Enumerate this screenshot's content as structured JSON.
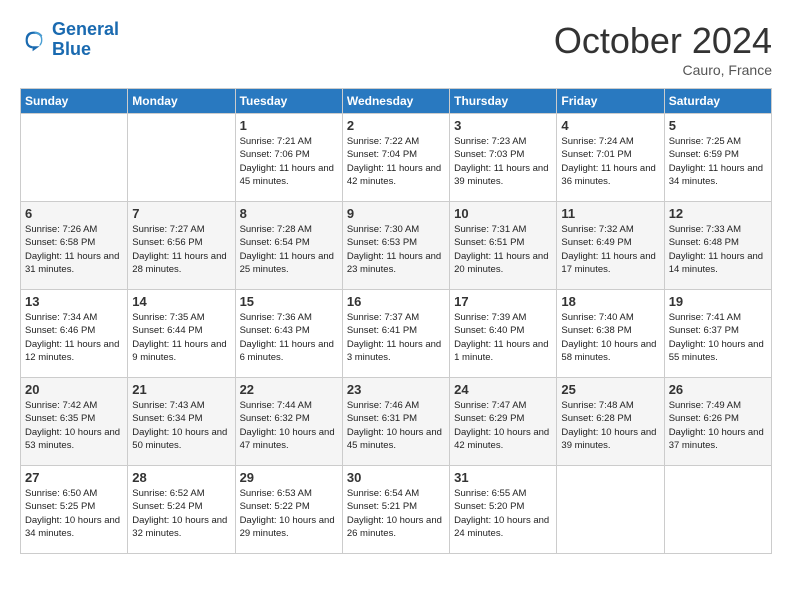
{
  "logo": {
    "line1": "General",
    "line2": "Blue"
  },
  "title": "October 2024",
  "location": "Cauro, France",
  "days_header": [
    "Sunday",
    "Monday",
    "Tuesday",
    "Wednesday",
    "Thursday",
    "Friday",
    "Saturday"
  ],
  "weeks": [
    [
      {
        "day": "",
        "info": ""
      },
      {
        "day": "",
        "info": ""
      },
      {
        "day": "1",
        "info": "Sunrise: 7:21 AM\nSunset: 7:06 PM\nDaylight: 11 hours and 45 minutes."
      },
      {
        "day": "2",
        "info": "Sunrise: 7:22 AM\nSunset: 7:04 PM\nDaylight: 11 hours and 42 minutes."
      },
      {
        "day": "3",
        "info": "Sunrise: 7:23 AM\nSunset: 7:03 PM\nDaylight: 11 hours and 39 minutes."
      },
      {
        "day": "4",
        "info": "Sunrise: 7:24 AM\nSunset: 7:01 PM\nDaylight: 11 hours and 36 minutes."
      },
      {
        "day": "5",
        "info": "Sunrise: 7:25 AM\nSunset: 6:59 PM\nDaylight: 11 hours and 34 minutes."
      }
    ],
    [
      {
        "day": "6",
        "info": "Sunrise: 7:26 AM\nSunset: 6:58 PM\nDaylight: 11 hours and 31 minutes."
      },
      {
        "day": "7",
        "info": "Sunrise: 7:27 AM\nSunset: 6:56 PM\nDaylight: 11 hours and 28 minutes."
      },
      {
        "day": "8",
        "info": "Sunrise: 7:28 AM\nSunset: 6:54 PM\nDaylight: 11 hours and 25 minutes."
      },
      {
        "day": "9",
        "info": "Sunrise: 7:30 AM\nSunset: 6:53 PM\nDaylight: 11 hours and 23 minutes."
      },
      {
        "day": "10",
        "info": "Sunrise: 7:31 AM\nSunset: 6:51 PM\nDaylight: 11 hours and 20 minutes."
      },
      {
        "day": "11",
        "info": "Sunrise: 7:32 AM\nSunset: 6:49 PM\nDaylight: 11 hours and 17 minutes."
      },
      {
        "day": "12",
        "info": "Sunrise: 7:33 AM\nSunset: 6:48 PM\nDaylight: 11 hours and 14 minutes."
      }
    ],
    [
      {
        "day": "13",
        "info": "Sunrise: 7:34 AM\nSunset: 6:46 PM\nDaylight: 11 hours and 12 minutes."
      },
      {
        "day": "14",
        "info": "Sunrise: 7:35 AM\nSunset: 6:44 PM\nDaylight: 11 hours and 9 minutes."
      },
      {
        "day": "15",
        "info": "Sunrise: 7:36 AM\nSunset: 6:43 PM\nDaylight: 11 hours and 6 minutes."
      },
      {
        "day": "16",
        "info": "Sunrise: 7:37 AM\nSunset: 6:41 PM\nDaylight: 11 hours and 3 minutes."
      },
      {
        "day": "17",
        "info": "Sunrise: 7:39 AM\nSunset: 6:40 PM\nDaylight: 11 hours and 1 minute."
      },
      {
        "day": "18",
        "info": "Sunrise: 7:40 AM\nSunset: 6:38 PM\nDaylight: 10 hours and 58 minutes."
      },
      {
        "day": "19",
        "info": "Sunrise: 7:41 AM\nSunset: 6:37 PM\nDaylight: 10 hours and 55 minutes."
      }
    ],
    [
      {
        "day": "20",
        "info": "Sunrise: 7:42 AM\nSunset: 6:35 PM\nDaylight: 10 hours and 53 minutes."
      },
      {
        "day": "21",
        "info": "Sunrise: 7:43 AM\nSunset: 6:34 PM\nDaylight: 10 hours and 50 minutes."
      },
      {
        "day": "22",
        "info": "Sunrise: 7:44 AM\nSunset: 6:32 PM\nDaylight: 10 hours and 47 minutes."
      },
      {
        "day": "23",
        "info": "Sunrise: 7:46 AM\nSunset: 6:31 PM\nDaylight: 10 hours and 45 minutes."
      },
      {
        "day": "24",
        "info": "Sunrise: 7:47 AM\nSunset: 6:29 PM\nDaylight: 10 hours and 42 minutes."
      },
      {
        "day": "25",
        "info": "Sunrise: 7:48 AM\nSunset: 6:28 PM\nDaylight: 10 hours and 39 minutes."
      },
      {
        "day": "26",
        "info": "Sunrise: 7:49 AM\nSunset: 6:26 PM\nDaylight: 10 hours and 37 minutes."
      }
    ],
    [
      {
        "day": "27",
        "info": "Sunrise: 6:50 AM\nSunset: 5:25 PM\nDaylight: 10 hours and 34 minutes."
      },
      {
        "day": "28",
        "info": "Sunrise: 6:52 AM\nSunset: 5:24 PM\nDaylight: 10 hours and 32 minutes."
      },
      {
        "day": "29",
        "info": "Sunrise: 6:53 AM\nSunset: 5:22 PM\nDaylight: 10 hours and 29 minutes."
      },
      {
        "day": "30",
        "info": "Sunrise: 6:54 AM\nSunset: 5:21 PM\nDaylight: 10 hours and 26 minutes."
      },
      {
        "day": "31",
        "info": "Sunrise: 6:55 AM\nSunset: 5:20 PM\nDaylight: 10 hours and 24 minutes."
      },
      {
        "day": "",
        "info": ""
      },
      {
        "day": "",
        "info": ""
      }
    ]
  ]
}
